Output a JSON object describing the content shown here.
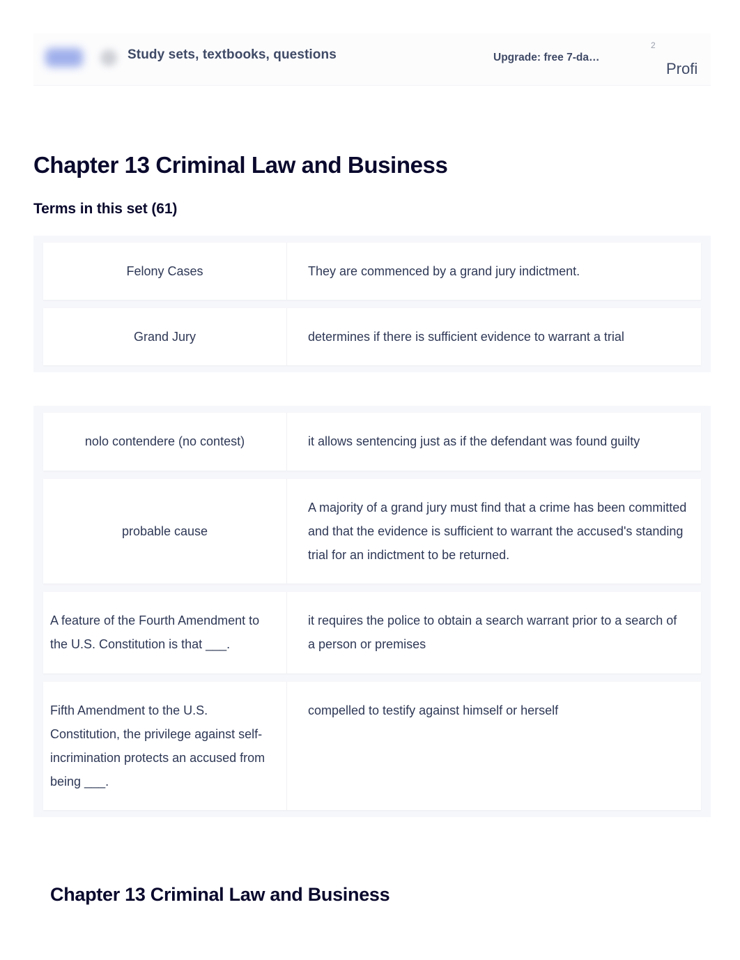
{
  "header": {
    "logo_icon": "quizlet-logo-icon",
    "search_icon": "search-icon",
    "nav_label": "Study sets, textbooks, questions",
    "upgrade_label": "Upgrade: free 7-da…",
    "notification_count": "2",
    "profile_label": "Profi"
  },
  "page": {
    "title": "Chapter 13 Criminal Law and Business",
    "terms_heading": "Terms in this set (61)",
    "footer_title": "Chapter 13 Criminal Law and Business"
  },
  "colors": {
    "accent": "#8fa2e8",
    "text": "#2e3856",
    "heading": "#0a092d",
    "group_bg": "#f6f7fb",
    "card_bg": "#ffffff"
  },
  "groups": [
    {
      "cards": [
        {
          "term": "Felony Cases",
          "definition": "They are commenced by a grand jury indictment.",
          "term_align": "center"
        },
        {
          "term": "Grand Jury",
          "definition": "determines if there is sufficient evidence to warrant a trial",
          "term_align": "center"
        }
      ]
    },
    {
      "cards": [
        {
          "term": "nolo contendere (no contest)",
          "definition": "it allows sentencing just as if the defendant was found guilty",
          "term_align": "center"
        },
        {
          "term": "probable cause",
          "definition": "A majority of a grand jury must find that a crime has been committed and that the evidence is sufficient to warrant the accused's standing trial for an indictment to be returned.",
          "term_align": "center"
        },
        {
          "term": "A feature of the Fourth Amendment to the U.S. Constitution is that ___.",
          "definition": "it requires the police to obtain a search warrant prior to a search of a person or premises",
          "term_align": "left"
        },
        {
          "term": "Fifth Amendment to the U.S. Constitution, the privilege against self-incrimination protects an accused from being ___.",
          "definition": "compelled to testify against himself or herself",
          "term_align": "left"
        }
      ]
    }
  ]
}
